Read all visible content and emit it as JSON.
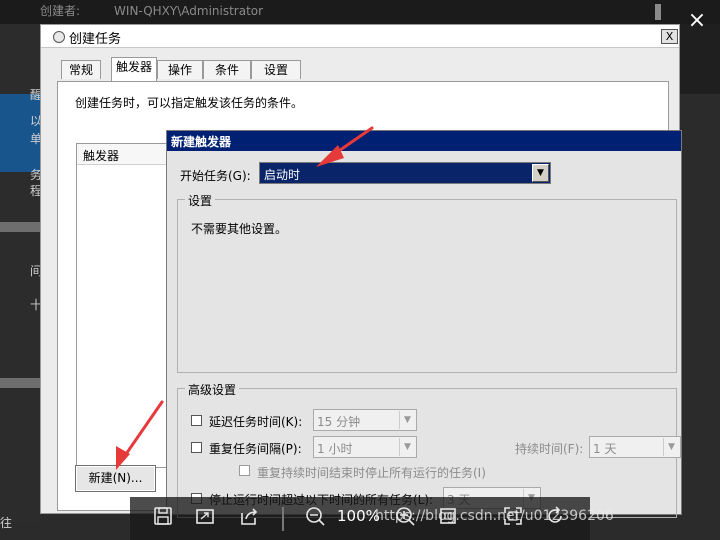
{
  "background": {
    "creator_label": "创建者:",
    "creator_value": "WIN-QHXY\\Administrator",
    "left_chars": [
      "醒",
      "以",
      "单",
      "务",
      "程",
      "间",
      "十"
    ],
    "bottom_char": "往"
  },
  "dialog": {
    "title": "创建任务",
    "close_label": "X",
    "tabs": [
      {
        "label": "常规"
      },
      {
        "label": "触发器"
      },
      {
        "label": "操作"
      },
      {
        "label": "条件"
      },
      {
        "label": "设置"
      }
    ],
    "description": "创建任务时，可以指定触发该任务的条件。",
    "trigger_list_header": "触发器",
    "new_button": "新建(N)..."
  },
  "new_trigger": {
    "title": "新建触发器",
    "start_task_label": "开始任务(G):",
    "start_task_value": "启动时",
    "settings_group_label": "设置",
    "no_settings_text": "不需要其他设置。",
    "advanced_group_label": "高级设置",
    "delay_label": "延迟任务时间(K):",
    "delay_value": "15 分钟",
    "repeat_label": "重复任务间隔(P):",
    "repeat_value": "1 小时",
    "duration_label": "持续时间(F):",
    "duration_value": "1 天",
    "stop_all_label": "重复持续时间结束时停止所有运行的任务(I)",
    "stop_after_label": "停止运行时间超过以下时间的所有任务(L):",
    "stop_after_value": "3 天"
  },
  "viewer": {
    "close_icon": "×",
    "zoom": "100%",
    "watermark": "https://blog.csdn.net/u012396206"
  },
  "colors": {
    "dialog_title_bar": "#002074",
    "selection": "#0a246a",
    "annotation_arrow": "#e63a3a"
  }
}
